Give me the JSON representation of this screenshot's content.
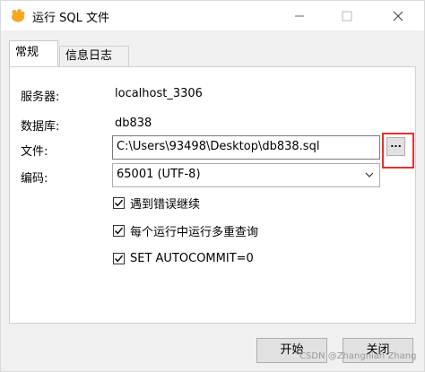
{
  "window": {
    "title": "运行 SQL 文件",
    "icon": "navicat-bird-icon",
    "controls": {
      "minimize": "minimize-icon",
      "maximize": "maximize-icon",
      "close": "close-icon"
    }
  },
  "tabs": [
    {
      "label": "常规",
      "active": true
    },
    {
      "label": "信息日志",
      "active": false
    }
  ],
  "form": {
    "server_label": "服务器:",
    "server_value": "localhost_3306",
    "database_label": "数据库:",
    "database_value": "db838",
    "file_label": "文件:",
    "file_value": "C:\\Users\\93498\\Desktop\\db838.sql",
    "browse_label": "...",
    "encoding_label": "编码:",
    "encoding_value": "65001 (UTF-8)"
  },
  "options": [
    {
      "label": "遇到错误继续",
      "checked": true
    },
    {
      "label": "每个运行中运行多重查询",
      "checked": true
    },
    {
      "label": "SET AUTOCOMMIT=0",
      "checked": true
    }
  ],
  "buttons": {
    "start": "开始",
    "close": "关闭"
  },
  "watermark": "CSDN @Zhangnian Zhang",
  "colors": {
    "highlight": "#e8302c",
    "icon": "#f5a623"
  }
}
